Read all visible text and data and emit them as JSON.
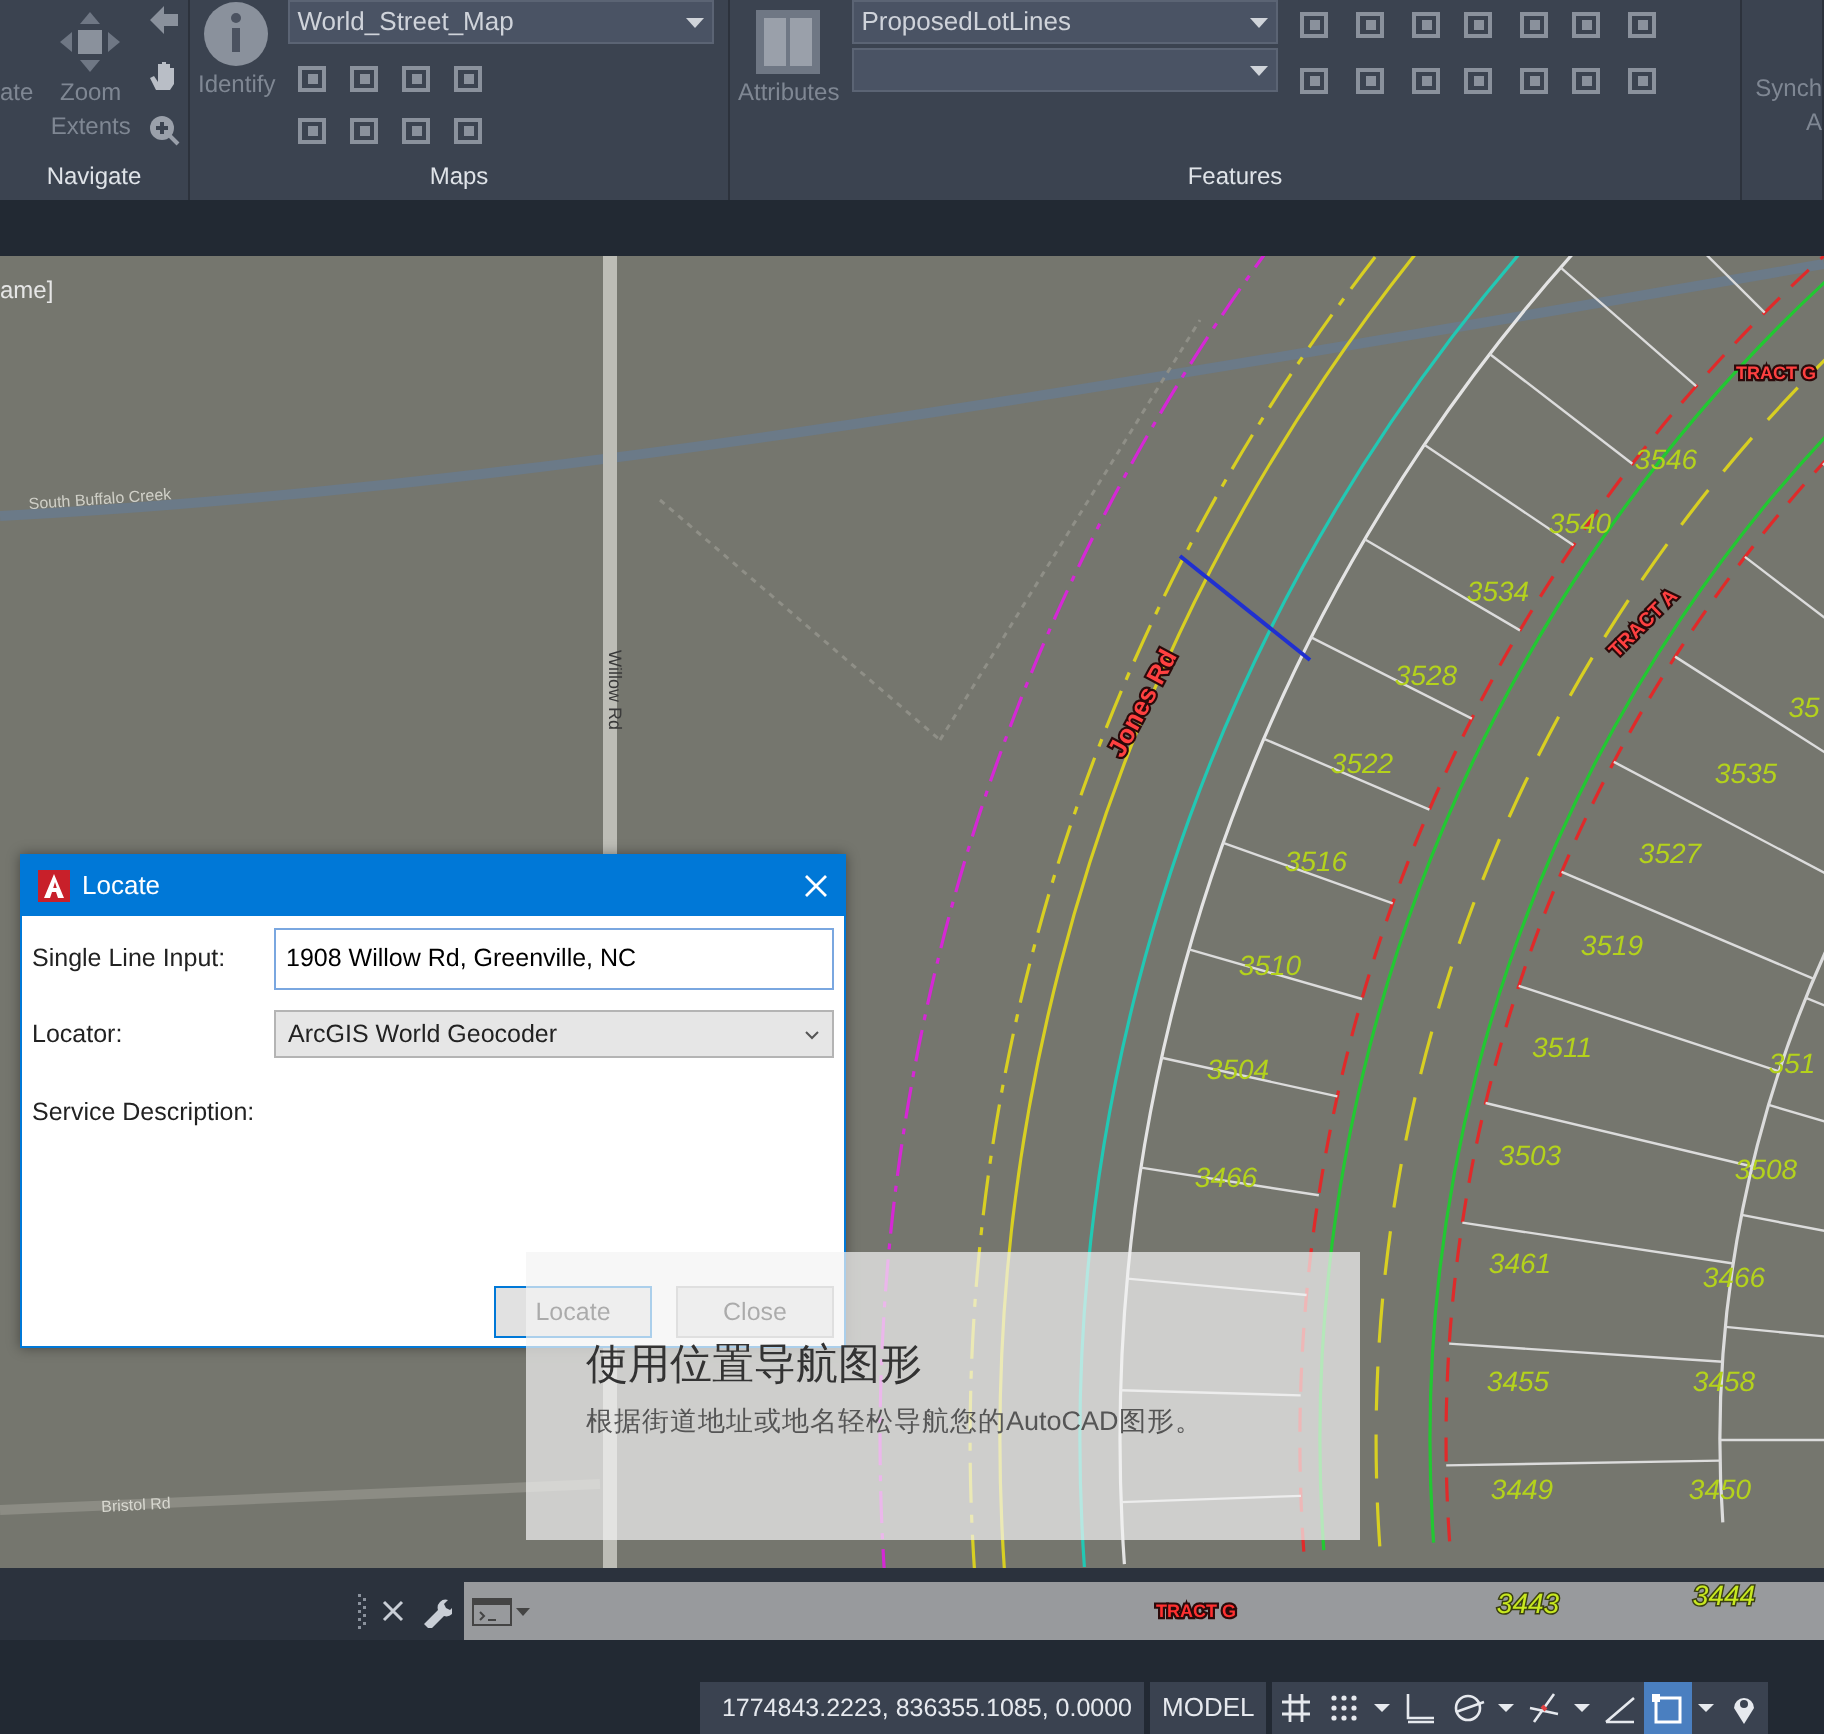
{
  "ribbon": {
    "panels": [
      {
        "title": "Navigate",
        "tools": [
          {
            "kind": "cut",
            "label": "ate"
          },
          {
            "kind": "large",
            "label": "Zoom Extents"
          }
        ]
      },
      {
        "title": "Maps",
        "tools": [
          {
            "kind": "large",
            "label": "Identify"
          }
        ],
        "combos": [
          {
            "kind": "text",
            "value": "World_Street_Map"
          }
        ]
      },
      {
        "title": "Features",
        "tools": [
          {
            "kind": "large",
            "label": "Attributes"
          }
        ],
        "combos": [
          {
            "kind": "text",
            "value": "ProposedLotLines"
          },
          {
            "kind": "blank"
          }
        ]
      },
      {
        "tools": [
          {
            "kind": "cut",
            "label": "Synch"
          },
          {
            "kind": "cut",
            "label": "A"
          }
        ]
      }
    ]
  },
  "drawing_tab": {
    "label": "ame]"
  },
  "map": {
    "labels": [
      {
        "kind": "base",
        "text": "South Buffalo Creek"
      },
      {
        "kind": "base",
        "text": "Willow Rd"
      },
      {
        "kind": "base",
        "text": "Bristol Rd"
      },
      {
        "kind": "plan",
        "text": "Jones Rd"
      },
      {
        "kind": "plan",
        "text": "TRACT G"
      },
      {
        "kind": "plan",
        "text": "TRACT A"
      },
      {
        "kind": "plan",
        "text": "TRACT G"
      }
    ],
    "lots": [
      "3546",
      "3540",
      "3534",
      "3528",
      "3522",
      "3516",
      "3510",
      "3504",
      "3466",
      "3535",
      "3527",
      "3519",
      "3511",
      "3503",
      "3508",
      "3461",
      "3466",
      "3455",
      "3458",
      "3449",
      "3450",
      "3443",
      "3444",
      "35",
      "351"
    ]
  },
  "dialog": {
    "title": "Locate",
    "fields": [
      {
        "kind": "text",
        "label": "Single Line Input:",
        "value": "1908 Willow Rd, Greenville, NC",
        "focused": true
      },
      {
        "kind": "select",
        "label": "Locator:",
        "value": "ArcGIS World Geocoder"
      },
      {
        "kind": "static",
        "label": "Service Description:"
      }
    ],
    "buttons": [
      {
        "label": "Locate",
        "default": true
      },
      {
        "label": "Close",
        "default": false
      }
    ]
  },
  "caption": {
    "title": "使用位置导航图形",
    "text": "根据街道地址或地名轻松导航您的AutoCAD图形。"
  },
  "status_bar": {
    "coordinates": "1774843.2223, 836355.1085, 0.0000",
    "space": "MODEL",
    "toggles": [
      {
        "kind": "grid",
        "on": false,
        "menu": false
      },
      {
        "kind": "snap",
        "on": false,
        "menu": true
      },
      {
        "kind": "ortho",
        "on": false,
        "menu": false
      },
      {
        "kind": "polar",
        "on": false,
        "menu": true
      },
      {
        "kind": "isodraft",
        "on": false,
        "menu": true
      },
      {
        "kind": "ucs",
        "on": false,
        "menu": false
      },
      {
        "kind": "selection",
        "on": true,
        "menu": true
      },
      {
        "kind": "geo",
        "on": false,
        "menu": false
      }
    ]
  }
}
